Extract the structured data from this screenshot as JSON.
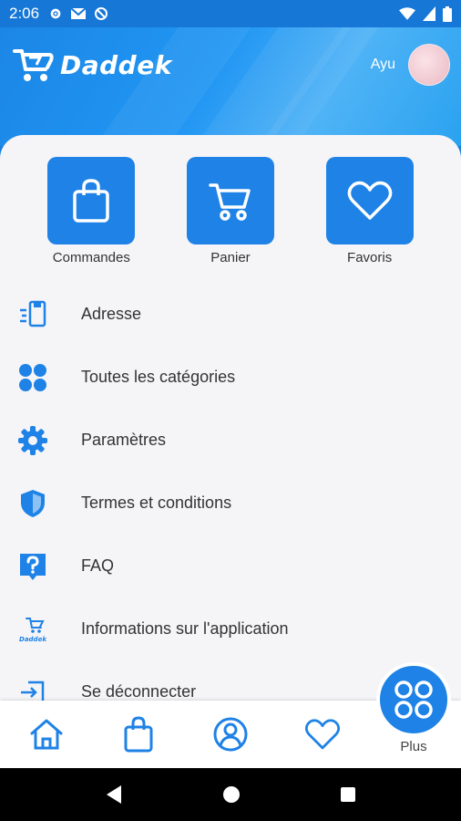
{
  "status_bar": {
    "time": "2:06"
  },
  "header": {
    "app_name": "Daddek",
    "user_name": "Ayu"
  },
  "tiles": [
    {
      "label": "Commandes",
      "icon": "bag-icon"
    },
    {
      "label": "Panier",
      "icon": "cart-icon"
    },
    {
      "label": "Favoris",
      "icon": "heart-icon"
    }
  ],
  "menu": [
    {
      "label": "Adresse",
      "icon": "address-icon"
    },
    {
      "label": "Toutes les catégories",
      "icon": "categories-icon"
    },
    {
      "label": "Paramètres",
      "icon": "gear-icon"
    },
    {
      "label": "Termes et conditions",
      "icon": "shield-icon"
    },
    {
      "label": "FAQ",
      "icon": "question-icon"
    },
    {
      "label": "Informations sur l'application",
      "icon": "app-logo-icon",
      "icon_text": "Daddek"
    },
    {
      "label": "Se déconnecter",
      "icon": "logout-icon"
    }
  ],
  "bottom_nav": {
    "items": [
      "home-icon",
      "bag-icon",
      "profile-icon",
      "heart-icon"
    ],
    "plus_label": "Plus"
  },
  "colors": {
    "primary": "#1e82e6",
    "header_light": "#4fb3f6",
    "panel_bg": "#f5f5f8",
    "text": "#333333"
  }
}
